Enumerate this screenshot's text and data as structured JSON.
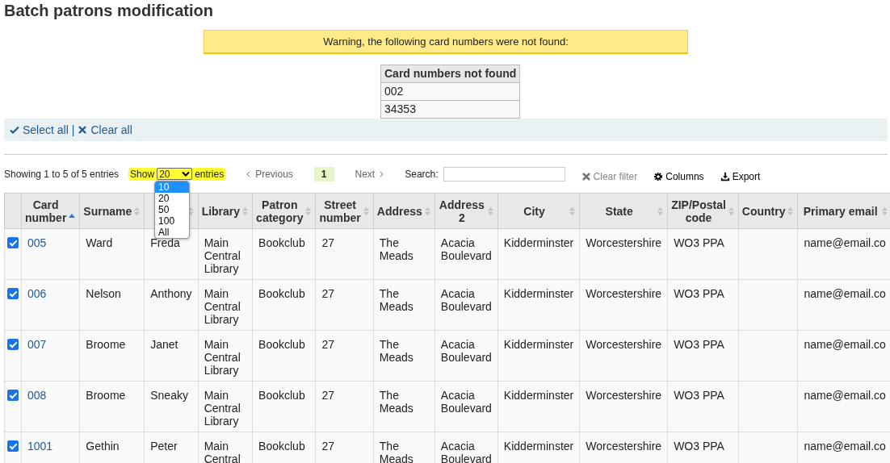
{
  "title": "Batch patrons modification",
  "warning": "Warning, the following card numbers were not found:",
  "not_found": {
    "heading": "Card numbers not found",
    "rows": [
      "002",
      "34353"
    ]
  },
  "selection_bar": {
    "select_all": "Select all",
    "separator": "|",
    "clear_all": "Clear all"
  },
  "toolbar": {
    "info": "Showing 1 to 5 of 5 entries",
    "show_label": "Show",
    "page_size": "20",
    "entries_label": "entries",
    "previous": "Previous",
    "page": "1",
    "next": "Next",
    "search_label": "Search:",
    "clear_filter": "Clear filter",
    "columns": "Columns",
    "export": "Export"
  },
  "page_size_options": [
    {
      "label": "10",
      "selected": true
    },
    {
      "label": "20",
      "selected": false
    },
    {
      "label": "50",
      "selected": false
    },
    {
      "label": "100",
      "selected": false
    },
    {
      "label": "All",
      "selected": false
    }
  ],
  "table": {
    "columns": [
      {
        "label": "Card number",
        "sorted": true
      },
      {
        "label": "Surname",
        "sorted": false
      },
      {
        "sorted": false
      },
      {
        "label": "Library",
        "sorted": false
      },
      {
        "label": "Patron category",
        "sorted": false
      },
      {
        "label": "Street number",
        "sorted": false
      },
      {
        "label": "Address",
        "sorted": false
      },
      {
        "label": "Address 2",
        "sorted": false
      },
      {
        "label": "City",
        "sorted": false
      },
      {
        "label": "State",
        "sorted": false
      },
      {
        "label": "ZIP/Postal code",
        "sorted": false
      },
      {
        "label": "Country",
        "sorted": false
      },
      {
        "label": "Primary email",
        "sorted": false
      }
    ],
    "rows": [
      {
        "checked": true,
        "cells": [
          "005",
          "Ward",
          "Freda",
          "Main Central Library",
          "Bookclub",
          "27",
          "The Meads",
          "Acacia Boulevard",
          "Kidderminster",
          "Worcestershire",
          "WO3 PPA",
          "",
          "name@email.co"
        ]
      },
      {
        "checked": true,
        "cells": [
          "006",
          "Nelson",
          "Anthony",
          "Main Central Library",
          "Bookclub",
          "27",
          "The Meads",
          "Acacia Boulevard",
          "Kidderminster",
          "Worcestershire",
          "WO3 PPA",
          "",
          "name@email.co"
        ]
      },
      {
        "checked": true,
        "cells": [
          "007",
          "Broome",
          "Janet",
          "Main Central Library",
          "Bookclub",
          "27",
          "The Meads",
          "Acacia Boulevard",
          "Kidderminster",
          "Worcestershire",
          "WO3 PPA",
          "",
          "name@email.co"
        ]
      },
      {
        "checked": true,
        "cells": [
          "008",
          "Broome",
          "Sneaky",
          "Main Central Library",
          "Bookclub",
          "27",
          "The Meads",
          "Acacia Boulevard",
          "Kidderminster",
          "Worcestershire",
          "WO3 PPA",
          "",
          "name@email.co"
        ]
      },
      {
        "checked": true,
        "cells": [
          "1001",
          "Gethin",
          "Peter",
          "Main Central",
          "Bookclub",
          "27",
          "The Meads",
          "Acacia Boulevard",
          "Kidderminster",
          "Worcestershire",
          "WO3 PPA",
          "",
          "name@email.co"
        ]
      }
    ]
  }
}
